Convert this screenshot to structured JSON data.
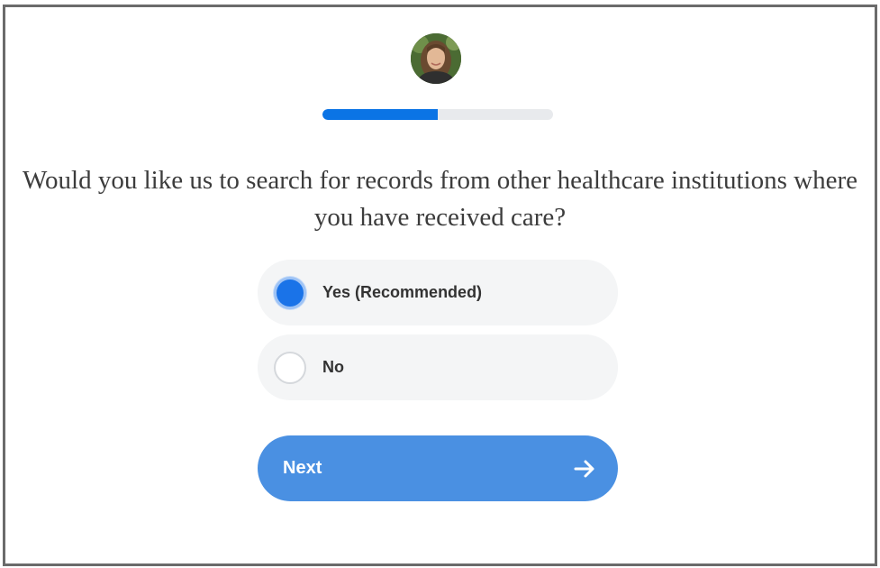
{
  "header": {
    "avatar_icon": "user-avatar-photo"
  },
  "progress": {
    "value_fraction": 0.5
  },
  "question": {
    "text": "Would you like us to search for records from other healthcare institutions where you have received care?"
  },
  "options": [
    {
      "label": "Yes (Recommended)",
      "selected": true
    },
    {
      "label": "No",
      "selected": false
    }
  ],
  "next_button": {
    "label": "Next",
    "icon": "arrow-right-icon"
  },
  "colors": {
    "accent": "#1a73e8",
    "button": "#4a90e2",
    "option_bg": "#f4f5f6",
    "progress_track": "#e8eaed"
  }
}
